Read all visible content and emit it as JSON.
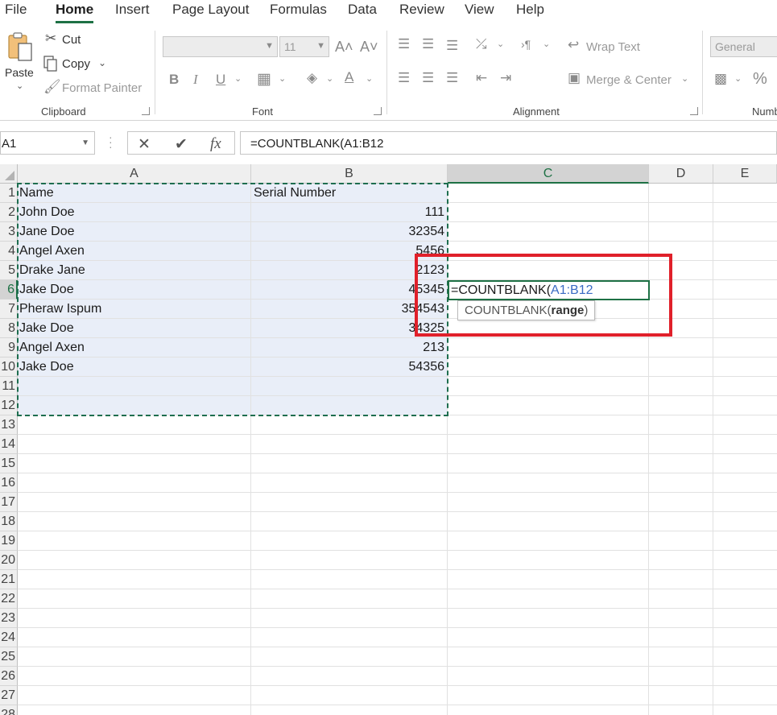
{
  "menu": {
    "tabs": [
      "File",
      "Home",
      "Insert",
      "Page Layout",
      "Formulas",
      "Data",
      "Review",
      "View",
      "Help"
    ],
    "active": "Home"
  },
  "ribbon": {
    "clipboard": {
      "paste_label": "Paste",
      "cut_label": "Cut",
      "copy_label": "Copy",
      "format_painter_label": "Format Painter",
      "group_label": "Clipboard"
    },
    "font": {
      "font_name_value": "",
      "font_size_value": "11",
      "bold": "B",
      "italic": "I",
      "underline": "U",
      "grow": "A˄",
      "shrink": "A˅",
      "fill_letter": "A",
      "group_label": "Font"
    },
    "alignment": {
      "wrap_text_label": "Wrap Text",
      "merge_center_label": "Merge & Center",
      "group_label": "Alignment"
    },
    "number": {
      "format_value": "General",
      "percent": "%",
      "group_label": "Numb"
    }
  },
  "formula_bar": {
    "name_box": "A1",
    "cancel": "✕",
    "enter": "✔",
    "fx": "fx",
    "formula": "=COUNTBLANK(A1:B12"
  },
  "sheet": {
    "columns": [
      "A",
      "B",
      "C",
      "D",
      "E"
    ],
    "selected_column": "C",
    "row_numbers": [
      "1",
      "2",
      "3",
      "4",
      "5",
      "6",
      "7",
      "8",
      "9",
      "10",
      "11",
      "12",
      "13",
      "14",
      "15",
      "16",
      "17",
      "18",
      "19",
      "20",
      "21",
      "22",
      "23",
      "24",
      "25",
      "26",
      "27",
      "28"
    ],
    "selected_row": "6",
    "rows": [
      {
        "a": "Name",
        "b": "Serial Number"
      },
      {
        "a": "John Doe",
        "b": "111"
      },
      {
        "a": "Jane Doe",
        "b": "32354"
      },
      {
        "a": "Angel Axen",
        "b": "5456"
      },
      {
        "a": "Drake Jane",
        "b": "2123"
      },
      {
        "a": "Jake Doe",
        "b": "45345"
      },
      {
        "a": "Pheraw Ispum",
        "b": "354543"
      },
      {
        "a": "Jake Doe",
        "b": "34325"
      },
      {
        "a": "Angel Axen",
        "b": "213"
      },
      {
        "a": "Jake Doe",
        "b": "54356"
      },
      {
        "a": "",
        "b": ""
      },
      {
        "a": "",
        "b": ""
      }
    ],
    "active_cell": {
      "prefix": "=COUNTBLANK(",
      "range_ref": "A1:B12"
    },
    "tooltip": {
      "func": "COUNTBLANK(",
      "arg": "range",
      "close": ")"
    }
  },
  "colors": {
    "accent": "#1e7145",
    "highlight_box": "#e0202a",
    "selection_fill": "#e9eef8",
    "range_ref": "#3a6bc4"
  }
}
